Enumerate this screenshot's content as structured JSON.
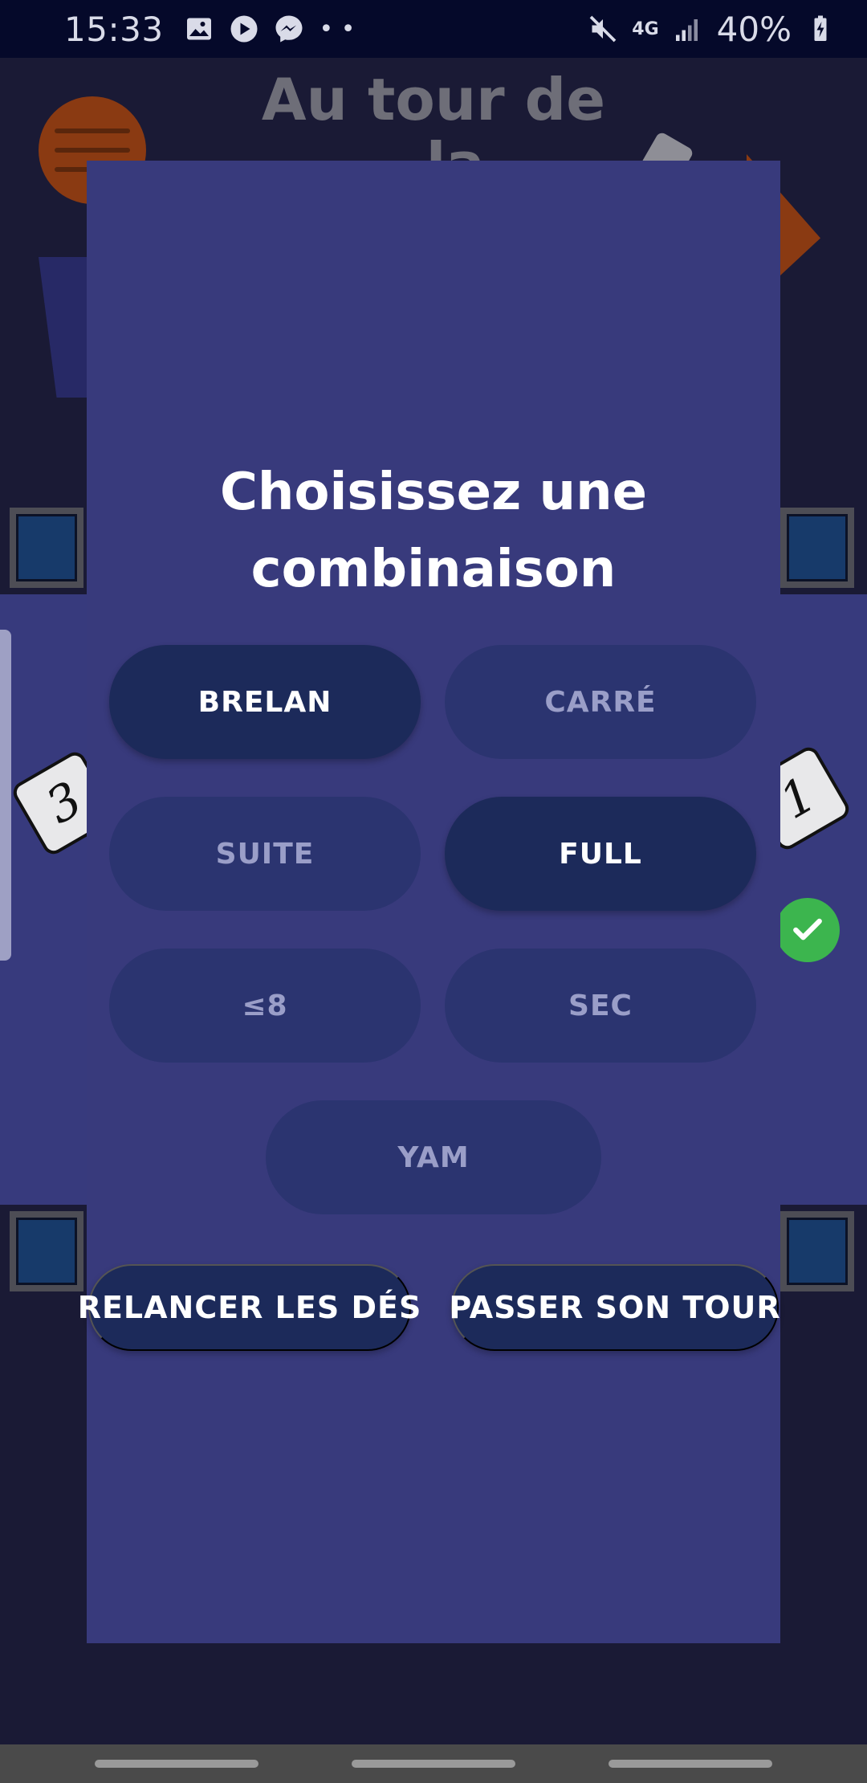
{
  "status_bar": {
    "time": "15:33",
    "network": "4G",
    "battery": "40%"
  },
  "background": {
    "title_line1": "Au tour de",
    "title_line2": "..la",
    "dice_values": [
      "3",
      "1"
    ]
  },
  "modal": {
    "title": "Choisissez une combinaison",
    "combinations": [
      {
        "label": "BRELAN",
        "enabled": true
      },
      {
        "label": "CARRÉ",
        "enabled": false
      },
      {
        "label": "SUITE",
        "enabled": false
      },
      {
        "label": "FULL",
        "enabled": true
      },
      {
        "label": "≤8",
        "enabled": false
      },
      {
        "label": "SEC",
        "enabled": false
      },
      {
        "label": "YAM",
        "enabled": false
      }
    ],
    "reroll_label": "RELANCER LES DÉS",
    "pass_label": "PASSER SON TOUR"
  },
  "colors": {
    "modal_bg": "#383a7c",
    "button_enabled": "#1c2a5a",
    "button_disabled": "#2b3470",
    "accent_check": "#3cb54e"
  }
}
